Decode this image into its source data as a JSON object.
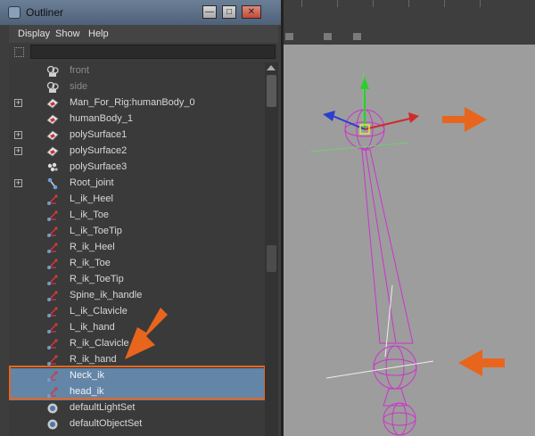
{
  "window": {
    "title": "Outliner"
  },
  "menu": [
    "Display",
    "Show",
    "Help"
  ],
  "search": {
    "value": ""
  },
  "items": [
    {
      "label": "front",
      "icon": "camera-icon",
      "expand": false,
      "dim": true
    },
    {
      "label": "side",
      "icon": "camera-icon",
      "expand": false,
      "dim": true
    },
    {
      "label": "Man_For_Rig:humanBody_0",
      "icon": "mesh-icon",
      "expand": true,
      "dim": false
    },
    {
      "label": "humanBody_1",
      "icon": "mesh-icon",
      "expand": false,
      "dim": false
    },
    {
      "label": "polySurface1",
      "icon": "mesh-icon",
      "expand": true,
      "dim": false
    },
    {
      "label": "polySurface2",
      "icon": "mesh-icon",
      "expand": true,
      "dim": false
    },
    {
      "label": "polySurface3",
      "icon": "group-icon",
      "expand": false,
      "dim": false
    },
    {
      "label": "Root_joint",
      "icon": "joint-icon",
      "expand": true,
      "dim": false
    },
    {
      "label": "L_ik_Heel",
      "icon": "ik-handle-icon",
      "expand": false,
      "dim": false
    },
    {
      "label": "L_ik_Toe",
      "icon": "ik-handle-icon",
      "expand": false,
      "dim": false
    },
    {
      "label": "L_ik_ToeTip",
      "icon": "ik-handle-icon",
      "expand": false,
      "dim": false
    },
    {
      "label": "R_ik_Heel",
      "icon": "ik-handle-icon",
      "expand": false,
      "dim": false
    },
    {
      "label": "R_ik_Toe",
      "icon": "ik-handle-icon",
      "expand": false,
      "dim": false
    },
    {
      "label": "R_ik_ToeTip",
      "icon": "ik-handle-icon",
      "expand": false,
      "dim": false
    },
    {
      "label": "Spine_ik_handle",
      "icon": "ik-handle-icon",
      "expand": false,
      "dim": false
    },
    {
      "label": "L_ik_Clavicle",
      "icon": "ik-handle-icon",
      "expand": false,
      "dim": false
    },
    {
      "label": "L_ik_hand",
      "icon": "ik-handle-icon",
      "expand": false,
      "dim": false
    },
    {
      "label": "R_ik_Clavicle",
      "icon": "ik-handle-icon",
      "expand": false,
      "dim": false
    },
    {
      "label": "R_ik_hand",
      "icon": "ik-handle-icon",
      "expand": false,
      "dim": false
    },
    {
      "label": "Neck_ik",
      "icon": "ik-handle-icon",
      "expand": false,
      "dim": false,
      "selected": true
    },
    {
      "label": "head_ik",
      "icon": "ik-handle-icon",
      "expand": false,
      "dim": false,
      "selected": true
    },
    {
      "label": "defaultLightSet",
      "icon": "set-icon",
      "expand": false,
      "dim": false
    },
    {
      "label": "defaultObjectSet",
      "icon": "set-icon",
      "expand": false,
      "dim": false
    }
  ],
  "colors": {
    "selection": "#6285a8",
    "annotation": "#e8651d",
    "wireframe": "#cc33cc"
  }
}
